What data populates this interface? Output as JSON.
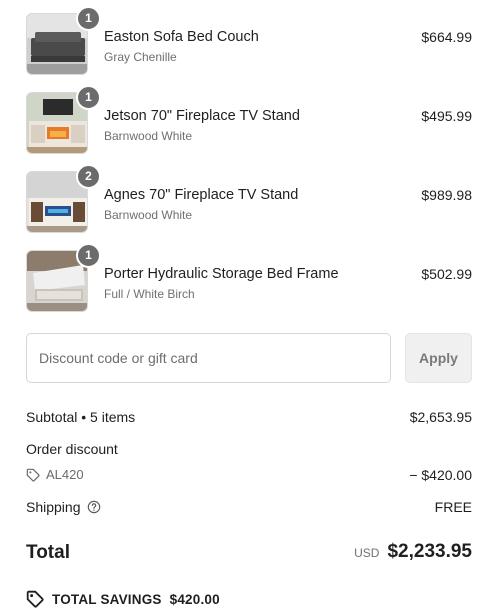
{
  "items": [
    {
      "qty": "1",
      "name": "Easton Sofa Bed Couch",
      "variant": "Gray Chenille",
      "price": "$664.99"
    },
    {
      "qty": "1",
      "name": "Jetson 70\" Fireplace TV Stand",
      "variant": "Barnwood White",
      "price": "$495.99"
    },
    {
      "qty": "2",
      "name": "Agnes 70\" Fireplace TV Stand",
      "variant": "Barnwood White",
      "price": "$989.98"
    },
    {
      "qty": "1",
      "name": "Porter Hydraulic Storage Bed Frame",
      "variant": "Full / White Birch",
      "price": "$502.99"
    }
  ],
  "discount": {
    "placeholder": "Discount code or gift card",
    "value": "",
    "apply_label": "Apply"
  },
  "summary": {
    "subtotal_label": "Subtotal • 5 items",
    "subtotal_value": "$2,653.95",
    "order_discount_label": "Order discount",
    "discount_code": "AL420",
    "discount_value": "− $420.00",
    "shipping_label": "Shipping",
    "shipping_value": "FREE",
    "total_label": "Total",
    "currency": "USD",
    "total_value": "$2,233.95",
    "savings_label": "TOTAL SAVINGS",
    "savings_value": "$420.00"
  },
  "icons": {
    "discount_tag": "tag-icon",
    "shipping_help": "question-circle-icon",
    "savings": "tag-icon"
  },
  "colors": {
    "badge": "#6b6b6b",
    "muted_text": "#707070",
    "button_bg": "#f0f0f0"
  }
}
